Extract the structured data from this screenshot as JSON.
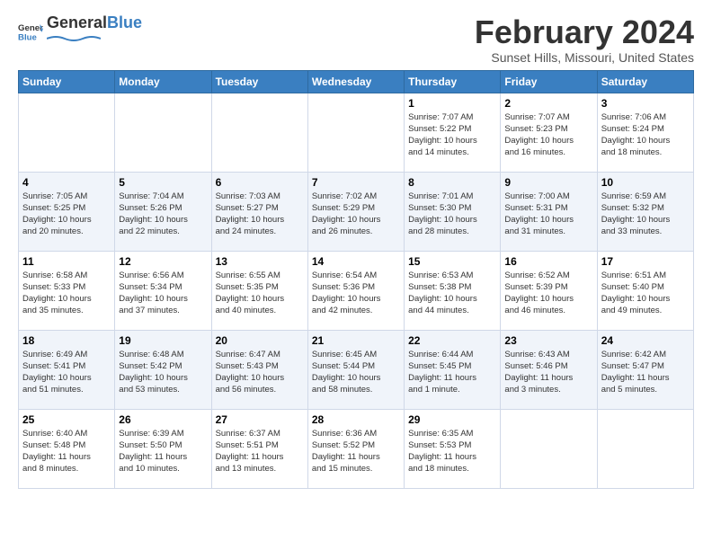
{
  "logo": {
    "general": "General",
    "blue": "Blue"
  },
  "title": "February 2024",
  "subtitle": "Sunset Hills, Missouri, United States",
  "weekdays": [
    "Sunday",
    "Monday",
    "Tuesday",
    "Wednesday",
    "Thursday",
    "Friday",
    "Saturday"
  ],
  "weeks": [
    [
      {
        "day": "",
        "info": ""
      },
      {
        "day": "",
        "info": ""
      },
      {
        "day": "",
        "info": ""
      },
      {
        "day": "",
        "info": ""
      },
      {
        "day": "1",
        "info": "Sunrise: 7:07 AM\nSunset: 5:22 PM\nDaylight: 10 hours\nand 14 minutes."
      },
      {
        "day": "2",
        "info": "Sunrise: 7:07 AM\nSunset: 5:23 PM\nDaylight: 10 hours\nand 16 minutes."
      },
      {
        "day": "3",
        "info": "Sunrise: 7:06 AM\nSunset: 5:24 PM\nDaylight: 10 hours\nand 18 minutes."
      }
    ],
    [
      {
        "day": "4",
        "info": "Sunrise: 7:05 AM\nSunset: 5:25 PM\nDaylight: 10 hours\nand 20 minutes."
      },
      {
        "day": "5",
        "info": "Sunrise: 7:04 AM\nSunset: 5:26 PM\nDaylight: 10 hours\nand 22 minutes."
      },
      {
        "day": "6",
        "info": "Sunrise: 7:03 AM\nSunset: 5:27 PM\nDaylight: 10 hours\nand 24 minutes."
      },
      {
        "day": "7",
        "info": "Sunrise: 7:02 AM\nSunset: 5:29 PM\nDaylight: 10 hours\nand 26 minutes."
      },
      {
        "day": "8",
        "info": "Sunrise: 7:01 AM\nSunset: 5:30 PM\nDaylight: 10 hours\nand 28 minutes."
      },
      {
        "day": "9",
        "info": "Sunrise: 7:00 AM\nSunset: 5:31 PM\nDaylight: 10 hours\nand 31 minutes."
      },
      {
        "day": "10",
        "info": "Sunrise: 6:59 AM\nSunset: 5:32 PM\nDaylight: 10 hours\nand 33 minutes."
      }
    ],
    [
      {
        "day": "11",
        "info": "Sunrise: 6:58 AM\nSunset: 5:33 PM\nDaylight: 10 hours\nand 35 minutes."
      },
      {
        "day": "12",
        "info": "Sunrise: 6:56 AM\nSunset: 5:34 PM\nDaylight: 10 hours\nand 37 minutes."
      },
      {
        "day": "13",
        "info": "Sunrise: 6:55 AM\nSunset: 5:35 PM\nDaylight: 10 hours\nand 40 minutes."
      },
      {
        "day": "14",
        "info": "Sunrise: 6:54 AM\nSunset: 5:36 PM\nDaylight: 10 hours\nand 42 minutes."
      },
      {
        "day": "15",
        "info": "Sunrise: 6:53 AM\nSunset: 5:38 PM\nDaylight: 10 hours\nand 44 minutes."
      },
      {
        "day": "16",
        "info": "Sunrise: 6:52 AM\nSunset: 5:39 PM\nDaylight: 10 hours\nand 46 minutes."
      },
      {
        "day": "17",
        "info": "Sunrise: 6:51 AM\nSunset: 5:40 PM\nDaylight: 10 hours\nand 49 minutes."
      }
    ],
    [
      {
        "day": "18",
        "info": "Sunrise: 6:49 AM\nSunset: 5:41 PM\nDaylight: 10 hours\nand 51 minutes."
      },
      {
        "day": "19",
        "info": "Sunrise: 6:48 AM\nSunset: 5:42 PM\nDaylight: 10 hours\nand 53 minutes."
      },
      {
        "day": "20",
        "info": "Sunrise: 6:47 AM\nSunset: 5:43 PM\nDaylight: 10 hours\nand 56 minutes."
      },
      {
        "day": "21",
        "info": "Sunrise: 6:45 AM\nSunset: 5:44 PM\nDaylight: 10 hours\nand 58 minutes."
      },
      {
        "day": "22",
        "info": "Sunrise: 6:44 AM\nSunset: 5:45 PM\nDaylight: 11 hours\nand 1 minute."
      },
      {
        "day": "23",
        "info": "Sunrise: 6:43 AM\nSunset: 5:46 PM\nDaylight: 11 hours\nand 3 minutes."
      },
      {
        "day": "24",
        "info": "Sunrise: 6:42 AM\nSunset: 5:47 PM\nDaylight: 11 hours\nand 5 minutes."
      }
    ],
    [
      {
        "day": "25",
        "info": "Sunrise: 6:40 AM\nSunset: 5:48 PM\nDaylight: 11 hours\nand 8 minutes."
      },
      {
        "day": "26",
        "info": "Sunrise: 6:39 AM\nSunset: 5:50 PM\nDaylight: 11 hours\nand 10 minutes."
      },
      {
        "day": "27",
        "info": "Sunrise: 6:37 AM\nSunset: 5:51 PM\nDaylight: 11 hours\nand 13 minutes."
      },
      {
        "day": "28",
        "info": "Sunrise: 6:36 AM\nSunset: 5:52 PM\nDaylight: 11 hours\nand 15 minutes."
      },
      {
        "day": "29",
        "info": "Sunrise: 6:35 AM\nSunset: 5:53 PM\nDaylight: 11 hours\nand 18 minutes."
      },
      {
        "day": "",
        "info": ""
      },
      {
        "day": "",
        "info": ""
      }
    ]
  ]
}
